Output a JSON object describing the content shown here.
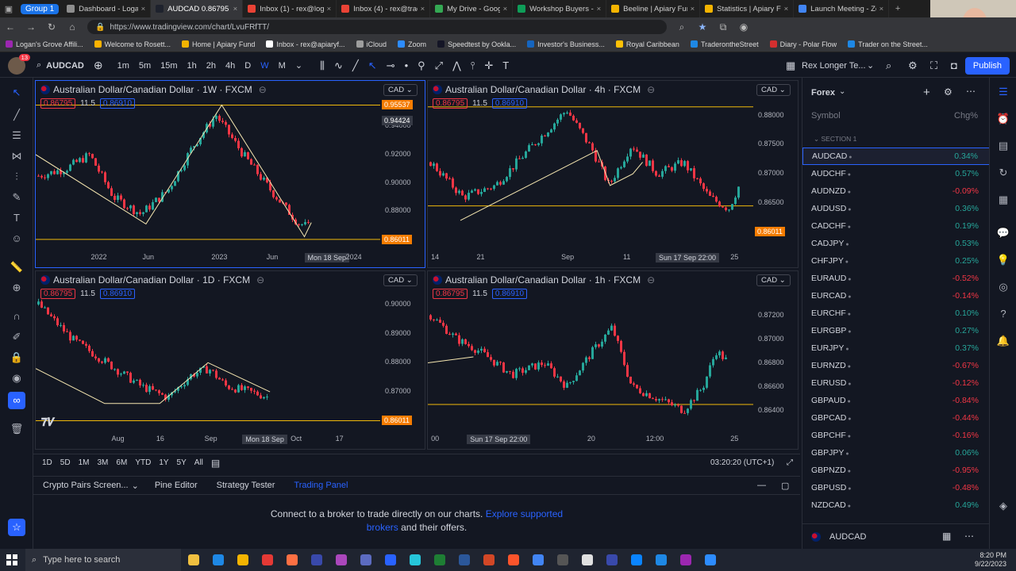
{
  "browser": {
    "group_label": "Group 1",
    "tabs": [
      {
        "title": "Dashboard - Logan's",
        "color": "#8e8e8e",
        "active": false
      },
      {
        "title": "AUDCAD 0.86795 ▲",
        "color": "#1e222d",
        "active": true
      },
      {
        "title": "Inbox (1) - rex@logan",
        "color": "#ea4335",
        "active": false
      },
      {
        "title": "Inbox (4) - rex@trade",
        "color": "#ea4335",
        "active": false
      },
      {
        "title": "My Drive - Google D",
        "color": "#34a853",
        "active": false
      },
      {
        "title": "Workshop Buyers - G",
        "color": "#0f9d58",
        "active": false
      },
      {
        "title": "Beeline | Apiary Fund",
        "color": "#f4b400",
        "active": false
      },
      {
        "title": "Statistics | Apiary Fu",
        "color": "#f4b400",
        "active": false
      },
      {
        "title": "Launch Meeting - Zo",
        "color": "#4285f4",
        "active": false
      }
    ],
    "url": "https://www.tradingview.com/chart/LvuFRfTT/",
    "bookmarks": [
      {
        "label": "Logan's Grove Affili...",
        "color": "#9c27b0"
      },
      {
        "label": "Welcome to Rosett...",
        "color": "#ffb300"
      },
      {
        "label": "Home | Apiary Fund",
        "color": "#f4b400"
      },
      {
        "label": "Inbox - rex@apiaryf...",
        "color": "#ffffff"
      },
      {
        "label": "iCloud",
        "color": "#9e9e9e"
      },
      {
        "label": "Zoom",
        "color": "#2d8cff"
      },
      {
        "label": "Speedtest by Ookla...",
        "color": "#141526"
      },
      {
        "label": "Investor's Business...",
        "color": "#1565c0"
      },
      {
        "label": "Royal Caribbean",
        "color": "#ffc107"
      },
      {
        "label": "TraderontheStreet",
        "color": "#1e88e5"
      },
      {
        "label": "Diary - Polar Flow",
        "color": "#d32f2f"
      },
      {
        "label": "Trader on the Street...",
        "color": "#1e88e5"
      }
    ]
  },
  "toolbar": {
    "badge": "13",
    "symbol": "AUDCAD",
    "intervals": [
      "1m",
      "5m",
      "15m",
      "1h",
      "2h",
      "4h",
      "D",
      "W",
      "M"
    ],
    "active_interval": "W",
    "layout_name": "Rex Longer Te...",
    "publish_label": "Publish"
  },
  "charts": [
    {
      "title": "Australian Dollar/Canadian Dollar · 1W · FXCM",
      "currency": "CAD",
      "bid": "0.86795",
      "spread": "11.5",
      "ask": "0.86910",
      "yticks": [
        {
          "label": "0.94000",
          "v": 0.94
        },
        {
          "label": "0.92000",
          "v": 0.92
        },
        {
          "label": "0.90000",
          "v": 0.9
        },
        {
          "label": "0.88000",
          "v": 0.88
        }
      ],
      "ymin": 0.855,
      "ymax": 0.962,
      "price_tags": [
        {
          "label": "0.95537",
          "v": 0.955,
          "color": "#f57c00"
        },
        {
          "label": "0.94424",
          "v": 0.9442,
          "color": "#363a45"
        },
        {
          "label": "0.86011",
          "v": 0.8601,
          "color": "#f57c00"
        }
      ],
      "xticks": [
        {
          "label": "2022",
          "x": 0.16
        },
        {
          "label": "Jun",
          "x": 0.31
        },
        {
          "label": "2023",
          "x": 0.51
        },
        {
          "label": "Jun",
          "x": 0.67
        },
        {
          "label": "Mon 18 Sep",
          "x": 0.78,
          "hl": true
        },
        {
          "label": "2024",
          "x": 0.9
        }
      ],
      "hlines": [
        0.955,
        0.8601
      ],
      "path": [
        [
          0.0,
          0.905
        ],
        [
          0.08,
          0.91
        ],
        [
          0.15,
          0.92
        ],
        [
          0.22,
          0.89
        ],
        [
          0.3,
          0.878
        ],
        [
          0.38,
          0.895
        ],
        [
          0.45,
          0.925
        ],
        [
          0.52,
          0.948
        ],
        [
          0.6,
          0.92
        ],
        [
          0.68,
          0.895
        ],
        [
          0.76,
          0.872
        ],
        [
          0.8,
          0.868
        ]
      ],
      "trend": [
        [
          0.0,
          0.92
        ],
        [
          0.32,
          0.871
        ],
        [
          0.54,
          0.955
        ],
        [
          0.78,
          0.862
        ],
        [
          0.8,
          0.872
        ]
      ]
    },
    {
      "title": "Australian Dollar/Canadian Dollar · 4h · FXCM",
      "currency": "CAD",
      "bid": "0.86795",
      "spread": "11.5",
      "ask": "0.86910",
      "yticks": [
        {
          "label": "0.88000",
          "v": 0.88
        },
        {
          "label": "0.87500",
          "v": 0.875
        },
        {
          "label": "0.87000",
          "v": 0.87
        },
        {
          "label": "0.86500",
          "v": 0.865
        }
      ],
      "ymin": 0.8575,
      "ymax": 0.8835,
      "price_tags": [
        {
          "label": "0.86011",
          "v": 0.8601,
          "color": "#f57c00"
        }
      ],
      "xticks": [
        {
          "label": "14",
          "x": 0.01
        },
        {
          "label": "21",
          "x": 0.15
        },
        {
          "label": "Sep",
          "x": 0.41
        },
        {
          "label": "11",
          "x": 0.6
        },
        {
          "label": "Sun 17 Sep  22:00",
          "x": 0.7,
          "hl": true
        },
        {
          "label": "25",
          "x": 0.93
        }
      ],
      "hlines": [
        0.8815,
        0.8645
      ],
      "path": [
        [
          0.0,
          0.872
        ],
        [
          0.1,
          0.866
        ],
        [
          0.2,
          0.868
        ],
        [
          0.3,
          0.874
        ],
        [
          0.42,
          0.881
        ],
        [
          0.5,
          0.874
        ],
        [
          0.55,
          0.868
        ],
        [
          0.62,
          0.875
        ],
        [
          0.7,
          0.87
        ],
        [
          0.78,
          0.872
        ],
        [
          0.86,
          0.866
        ],
        [
          0.92,
          0.864
        ],
        [
          0.96,
          0.869
        ]
      ],
      "trend": [
        [
          0.1,
          0.862
        ],
        [
          0.52,
          0.874
        ],
        [
          0.56,
          0.868
        ],
        [
          0.63,
          0.87
        ],
        [
          0.66,
          0.872
        ]
      ]
    },
    {
      "title": "Australian Dollar/Canadian Dollar · 1D · FXCM",
      "currency": "CAD",
      "bid": "0.86795",
      "spread": "11.5",
      "ask": "0.86910",
      "yticks": [
        {
          "label": "0.90000",
          "v": 0.9
        },
        {
          "label": "0.89000",
          "v": 0.89
        },
        {
          "label": "0.88000",
          "v": 0.88
        },
        {
          "label": "0.87000",
          "v": 0.87
        }
      ],
      "ymin": 0.8575,
      "ymax": 0.9065,
      "price_tags": [
        {
          "label": "0.86011",
          "v": 0.8601,
          "color": "#f57c00"
        }
      ],
      "xticks": [
        {
          "label": "Aug",
          "x": 0.22
        },
        {
          "label": "16",
          "x": 0.35
        },
        {
          "label": "Sep",
          "x": 0.49
        },
        {
          "label": "Mon 18 Sep",
          "x": 0.6,
          "hl": true
        },
        {
          "label": "Oct",
          "x": 0.74
        },
        {
          "label": "17",
          "x": 0.87
        }
      ],
      "hlines": [
        0.8601
      ],
      "path": [
        [
          0.0,
          0.9
        ],
        [
          0.1,
          0.888
        ],
        [
          0.2,
          0.88
        ],
        [
          0.3,
          0.872
        ],
        [
          0.38,
          0.868
        ],
        [
          0.45,
          0.876
        ],
        [
          0.5,
          0.878
        ],
        [
          0.55,
          0.872
        ],
        [
          0.62,
          0.87
        ],
        [
          0.68,
          0.868
        ]
      ],
      "trend": [
        [
          0.0,
          0.878
        ],
        [
          0.2,
          0.866
        ],
        [
          0.36,
          0.866
        ],
        [
          0.5,
          0.88
        ],
        [
          0.68,
          0.87
        ]
      ]
    },
    {
      "title": "Australian Dollar/Canadian Dollar · 1h · FXCM",
      "currency": "CAD",
      "bid": "0.86795",
      "spread": "11.5",
      "ask": "0.86910",
      "yticks": [
        {
          "label": "0.87200",
          "v": 0.872
        },
        {
          "label": "0.87000",
          "v": 0.87
        },
        {
          "label": "0.86800",
          "v": 0.868
        },
        {
          "label": "0.86600",
          "v": 0.866
        },
        {
          "label": "0.86400",
          "v": 0.864
        }
      ],
      "ymin": 0.8625,
      "ymax": 0.8745,
      "price_tags": [],
      "xticks": [
        {
          "label": "00",
          "x": 0.01
        },
        {
          "label": "Sun 17 Sep  22:00",
          "x": 0.12,
          "hl": true
        },
        {
          "label": "20",
          "x": 0.49
        },
        {
          "label": "12:00",
          "x": 0.67
        },
        {
          "label": "25",
          "x": 0.93
        }
      ],
      "hlines": [
        0.8645
      ],
      "path": [
        [
          0.0,
          0.872
        ],
        [
          0.08,
          0.87
        ],
        [
          0.15,
          0.869
        ],
        [
          0.25,
          0.867
        ],
        [
          0.35,
          0.868
        ],
        [
          0.42,
          0.866
        ],
        [
          0.5,
          0.869
        ],
        [
          0.56,
          0.871
        ],
        [
          0.62,
          0.866
        ],
        [
          0.7,
          0.865
        ],
        [
          0.78,
          0.864
        ],
        [
          0.84,
          0.866
        ],
        [
          0.88,
          0.869
        ],
        [
          0.92,
          0.868
        ]
      ],
      "trend": [
        [
          0.0,
          0.868
        ],
        [
          0.14,
          0.8685
        ]
      ]
    }
  ],
  "range_buttons": [
    "1D",
    "5D",
    "1M",
    "3M",
    "6M",
    "YTD",
    "1Y",
    "5Y",
    "All"
  ],
  "clock": "03:20:20 (UTC+1)",
  "panel_tabs": [
    {
      "label": "Crypto Pairs Screen...",
      "active": false
    },
    {
      "label": "Pine Editor",
      "active": false
    },
    {
      "label": "Strategy Tester",
      "active": false
    },
    {
      "label": "Trading Panel",
      "active": true
    }
  ],
  "connect": {
    "text1": "Connect to a broker to trade directly on our charts.",
    "link1": "Explore supported",
    "link2": "brokers",
    "text2": "and their offers."
  },
  "watchlist": {
    "title": "Forex",
    "col_symbol": "Symbol",
    "col_change": "Chg%",
    "section": "SECTION 1",
    "selected": "AUDCAD",
    "rows": [
      {
        "symbol": "AUDCAD",
        "change": "0.34%",
        "up": true
      },
      {
        "symbol": "AUDCHF",
        "change": "0.57%",
        "up": true
      },
      {
        "symbol": "AUDNZD",
        "change": "-0.09%",
        "up": false
      },
      {
        "symbol": "AUDUSD",
        "change": "0.36%",
        "up": true
      },
      {
        "symbol": "CADCHF",
        "change": "0.19%",
        "up": true
      },
      {
        "symbol": "CADJPY",
        "change": "0.53%",
        "up": true
      },
      {
        "symbol": "CHFJPY",
        "change": "0.25%",
        "up": true
      },
      {
        "symbol": "EURAUD",
        "change": "-0.52%",
        "up": false
      },
      {
        "symbol": "EURCAD",
        "change": "-0.14%",
        "up": false
      },
      {
        "symbol": "EURCHF",
        "change": "0.10%",
        "up": true
      },
      {
        "symbol": "EURGBP",
        "change": "0.27%",
        "up": true
      },
      {
        "symbol": "EURJPY",
        "change": "0.37%",
        "up": true
      },
      {
        "symbol": "EURNZD",
        "change": "-0.67%",
        "up": false
      },
      {
        "symbol": "EURUSD",
        "change": "-0.12%",
        "up": false
      },
      {
        "symbol": "GBPAUD",
        "change": "-0.84%",
        "up": false
      },
      {
        "symbol": "GBPCAD",
        "change": "-0.44%",
        "up": false
      },
      {
        "symbol": "GBPCHF",
        "change": "-0.16%",
        "up": false
      },
      {
        "symbol": "GBPJPY",
        "change": "0.06%",
        "up": true
      },
      {
        "symbol": "GBPNZD",
        "change": "-0.95%",
        "up": false
      },
      {
        "symbol": "GBPUSD",
        "change": "-0.48%",
        "up": false
      },
      {
        "symbol": "NZDCAD",
        "change": "0.49%",
        "up": true
      }
    ],
    "footer_symbol": "AUDCAD"
  },
  "taskbar": {
    "search_placeholder": "Type here to search",
    "time": "8:20 PM",
    "date": "9/22/2023",
    "apps": [
      "#f0c040",
      "#1e88e5",
      "#f4b400",
      "#e53935",
      "#ff7043",
      "#3949ab",
      "#ab47bc",
      "#5c6bc0",
      "#2962ff",
      "#26c6da",
      "#1e7e34",
      "#2b579a",
      "#d24726",
      "#fb542b",
      "#4285f4",
      "#555",
      "#e0e0e0",
      "#3949ab",
      "#0a84ff",
      "#1e88e5",
      "#9c27b0",
      "#2d8cff"
    ],
    "colors": {
      "up": "#26a69a",
      "down": "#f23645",
      "accent": "#2962ff"
    }
  }
}
